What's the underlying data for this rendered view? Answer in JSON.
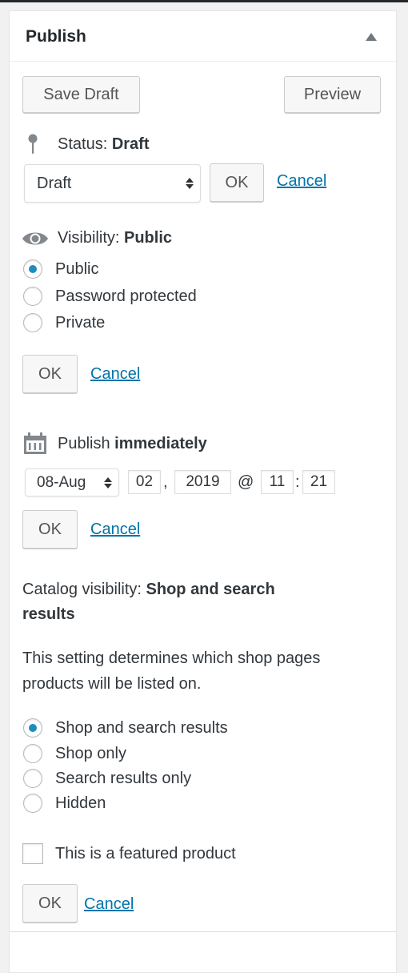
{
  "panel": {
    "title": "Publish",
    "toggle_icon": "triangle-up-icon"
  },
  "actions": {
    "save_draft_label": "Save Draft",
    "preview_label": "Preview"
  },
  "status": {
    "icon": "pin-icon",
    "label": "Status:",
    "value": "Draft",
    "select_value": "Draft",
    "ok_label": "OK",
    "cancel_label": "Cancel"
  },
  "visibility": {
    "icon": "eye-icon",
    "label": "Visibility:",
    "value": "Public",
    "options": [
      {
        "label": "Public",
        "checked": true
      },
      {
        "label": "Password protected",
        "checked": false
      },
      {
        "label": "Private",
        "checked": false
      }
    ],
    "ok_label": "OK",
    "cancel_label": "Cancel"
  },
  "schedule": {
    "icon": "calendar-icon",
    "label": "Publish",
    "value": "immediately",
    "month": "08-Aug",
    "day": "02",
    "comma": ",",
    "year": "2019",
    "at": "@",
    "hour": "11",
    "colon": ":",
    "minute": "21",
    "ok_label": "OK",
    "cancel_label": "Cancel"
  },
  "catalog": {
    "label": "Catalog visibility:",
    "value_line1": "Shop and search",
    "value_line2": "results",
    "description_line1": "This setting determines which shop pages",
    "description_line2": "products will be listed on.",
    "options": [
      {
        "label": "Shop and search results",
        "checked": true
      },
      {
        "label": "Shop only",
        "checked": false
      },
      {
        "label": "Search results only",
        "checked": false
      },
      {
        "label": "Hidden",
        "checked": false
      }
    ],
    "featured_label": "This is a featured product",
    "featured_checked": false,
    "ok_label": "OK",
    "cancel_label": "Cancel"
  },
  "colors": {
    "link": "#0073aa",
    "radio_dot": "#1e8cbe",
    "text": "#32373c"
  }
}
